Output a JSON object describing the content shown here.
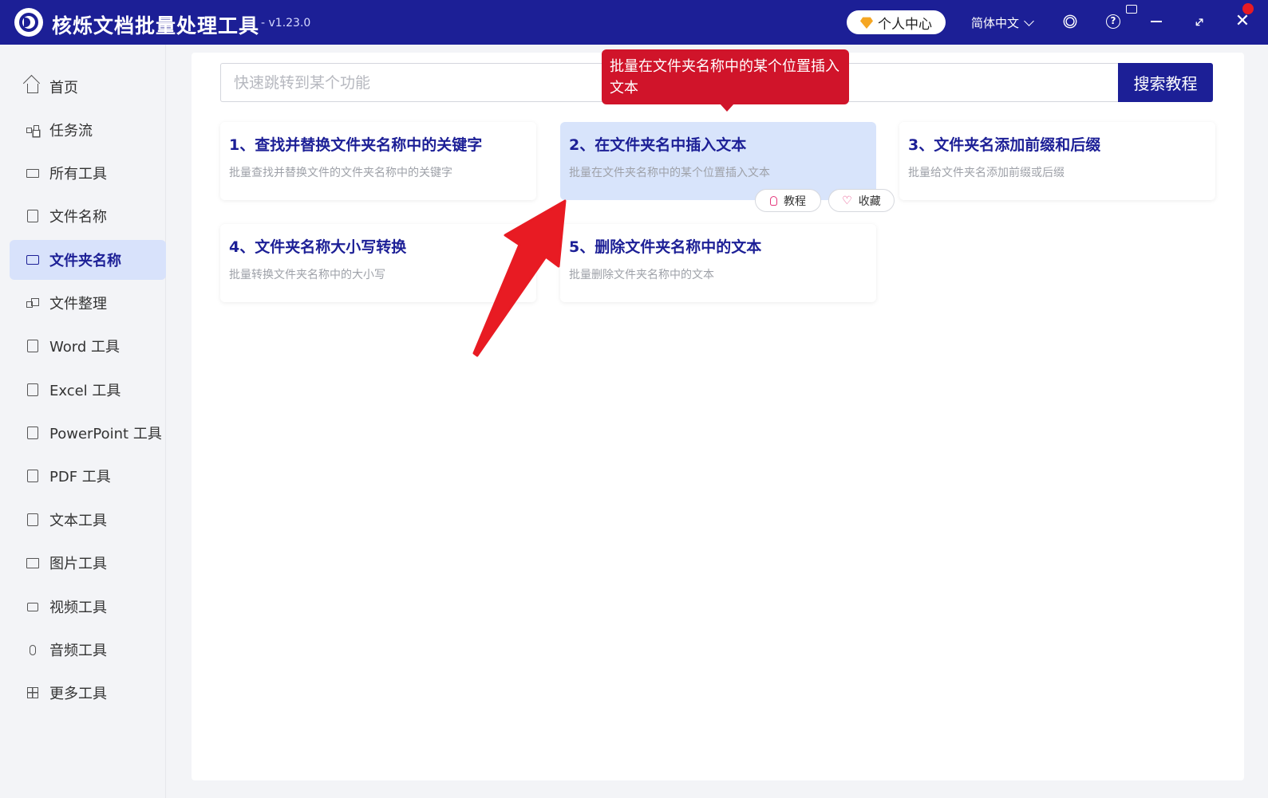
{
  "app": {
    "title": "核烁文档批量处理工具",
    "version": "- v1.23.0",
    "user_center": "个人中心",
    "language": "简体中文"
  },
  "sidebar": {
    "items": [
      {
        "label": "首页",
        "icon": "home-icon"
      },
      {
        "label": "任务流",
        "icon": "flow-icon"
      },
      {
        "label": "所有工具",
        "icon": "monitor-icon"
      },
      {
        "label": "文件名称",
        "icon": "file-icon"
      },
      {
        "label": "文件夹名称",
        "icon": "folder-icon",
        "active": true
      },
      {
        "label": "文件整理",
        "icon": "organize-icon"
      },
      {
        "label": "Word 工具",
        "icon": "word-icon"
      },
      {
        "label": "Excel 工具",
        "icon": "excel-icon"
      },
      {
        "label": "PowerPoint 工具",
        "icon": "powerpoint-icon"
      },
      {
        "label": "PDF 工具",
        "icon": "pdf-icon"
      },
      {
        "label": "文本工具",
        "icon": "text-icon"
      },
      {
        "label": "图片工具",
        "icon": "image-icon"
      },
      {
        "label": "视频工具",
        "icon": "video-icon"
      },
      {
        "label": "音频工具",
        "icon": "audio-icon"
      },
      {
        "label": "更多工具",
        "icon": "more-icon"
      }
    ]
  },
  "search": {
    "placeholder": "快速跳转到某个功能",
    "button": "搜索教程"
  },
  "cards": [
    {
      "title": "1、查找并替换文件夹名称中的关键字",
      "desc": "批量查找并替换文件的文件夹名称中的关键字"
    },
    {
      "title": "2、在文件夹名中插入文本",
      "desc": "批量在文件夹名称中的某个位置插入文本"
    },
    {
      "title": "3、文件夹名添加前缀和后缀",
      "desc": "批量给文件夹名添加前缀或后缀"
    },
    {
      "title": "4、文件夹名称大小写转换",
      "desc": "批量转换文件夹名称中的大小写"
    },
    {
      "title": "5、删除文件夹名称中的文本",
      "desc": "批量删除文件夹名称中的文本"
    }
  ],
  "card_actions": {
    "tutorial": "教程",
    "favorite": "收藏"
  },
  "tooltip": {
    "text": "批量在文件夹名称中的某个位置插入文本"
  },
  "colors": {
    "primary": "#1c1f96",
    "tooltip": "#d0142a",
    "arrow": "#e81b23",
    "hover_card": "#d8e4fb"
  }
}
